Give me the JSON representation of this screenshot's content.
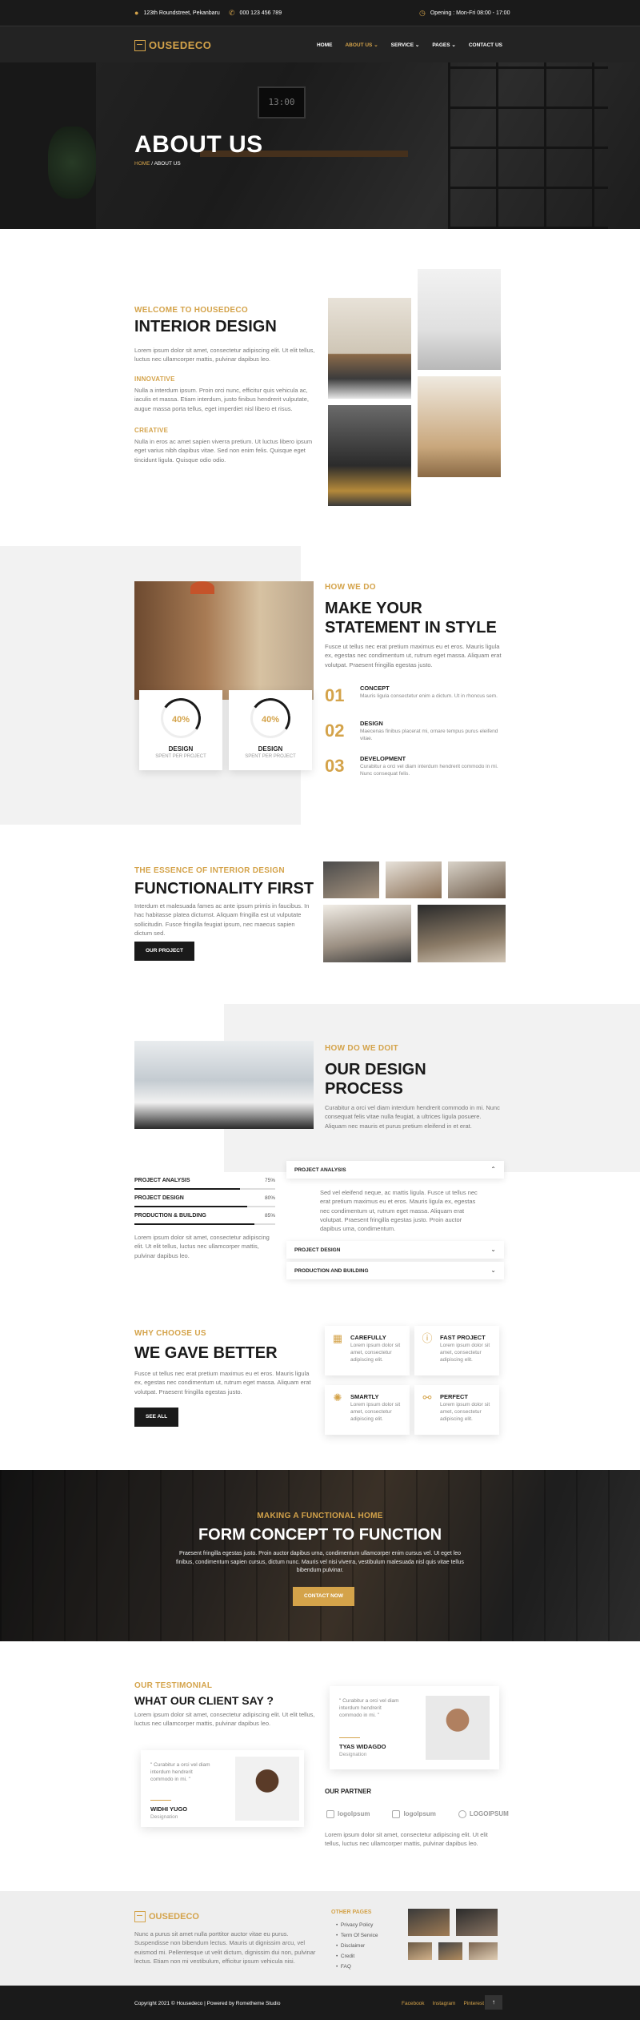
{
  "topbar": {
    "address": "123th Roundstreet, Pekanbaru",
    "phone": "000 123 456 789",
    "hours": "Opening : Mon-Fri 08:00 - 17:00"
  },
  "brand": {
    "logo_text": "OUSEDECO",
    "accent": "#d4a34a"
  },
  "nav": {
    "items": [
      {
        "label": "HOME"
      },
      {
        "label": "ABOUT US ⌄"
      },
      {
        "label": "SERVICE ⌄"
      },
      {
        "label": "PAGES ⌄"
      },
      {
        "label": "CONTACT US"
      }
    ]
  },
  "hero": {
    "title": "ABOUT US",
    "crumb_home": "HOME",
    "crumb_sep": " / ",
    "crumb_current": "ABOUT US",
    "clock": "13:00"
  },
  "intro": {
    "label": "WELCOME TO HOUSEDECO",
    "title": "INTERIOR DESIGN",
    "text": "Lorem ipsum dolor sit amet, consectetur adipiscing elit. Ut elit tellus, luctus nec ullamcorper mattis, pulvinar dapibus leo.",
    "sub1": "INNOVATIVE",
    "sub1_text": "Nulla a interdum ipsum. Proin orci nunc, efficitur quis vehicula ac, iaculis et massa. Etiam interdum, justo finibus hendrerit vulputate, augue massa porta tellus, eget imperdiet nisl libero et risus.",
    "sub2": "CREATIVE",
    "sub2_text": "Nulla in eros ac amet sapien viverra pretium. Ut luctus libero ipsum eget varius nibh dapibus vitae. Sed non enim felis. Quisque eget tincidunt ligula. Quisque odio odio."
  },
  "how": {
    "label": "HOW WE DO",
    "title1": "MAKE YOUR",
    "title2": "STATEMENT IN STYLE",
    "text": "Fusce ut tellus nec erat pretium maximus eu et eros. Mauris ligula ex, egestas nec condimentum ut, rutrum eget massa. Aliquam erat volutpat. Praesent fringilla egestas justo.",
    "cards": [
      {
        "pct": "40%",
        "title": "DESIGN",
        "sub": "SPENT PER PROJECT"
      },
      {
        "pct": "40%",
        "title": "DESIGN",
        "sub": "SPENT PER PROJECT"
      }
    ],
    "steps": [
      {
        "n": "01",
        "title": "CONCEPT",
        "text": "Mauris ligula consectetur enim a dictum. Ut in rhoncus sem."
      },
      {
        "n": "02",
        "title": "DESIGN",
        "text": "Maecenas finibus placerat mi, ornare tempus purus eleifend vitae."
      },
      {
        "n": "03",
        "title": "DEVELOPMENT",
        "text": "Curabitur a orci vel diam interdum hendrerit commodo in mi. Nunc consequat felis."
      }
    ]
  },
  "essence": {
    "label": "THE ESSENCE OF INTERIOR DESIGN",
    "title": "FUNCTIONALITY FIRST",
    "text": "Interdum et malesuada fames ac ante ipsum primis in faucibus. In hac habitasse platea dictumst. Aliquam fringilla est ut vulputate sollicitudin. Fusce fringilla feugiat ipsum, nec maecus sapien dictum sed.",
    "button": "OUR PROJECT"
  },
  "process": {
    "label": "HOW DO WE DOIT",
    "title1": "OUR DESIGN",
    "title2": "PROCESS",
    "text": "Curabitur a orci vel diam interdum hendrerit commodo in mi. Nunc consequat felis vitae nulla feugiat, a ultrices ligula posuere. Aliquam nec mauris et purus pretium eleifend in et erat.",
    "bars": [
      {
        "label": "PROJECT ANALYSIS",
        "pct": "75%",
        "value": 0.75
      },
      {
        "label": "PROJECT DESIGN",
        "pct": "80%",
        "value": 0.8
      },
      {
        "label": "PRODUCTION & BUILDING",
        "pct": "85%",
        "value": 0.85
      }
    ],
    "bars_text": "Lorem ipsum dolor sit amet, consectetur adipiscing elit. Ut elit tellus, luctus nec ullamcorper mattis, pulvinar dapibus leo.",
    "acc1": "PROJECT ANALYSIS",
    "acc1_text": "Sed vel eleifend neque, ac mattis ligula. Fusce ut tellus nec erat pretium maximus eu et eros. Mauris ligula ex, egestas nec condimentum ut, rutrum eget massa. Aliquam erat volutpat. Praesent fringilla egestas justo. Proin auctor dapibus uma, condimentum.",
    "acc2": "PROJECT DESIGN",
    "acc3": "PRODUCTION AND BUILDING"
  },
  "why": {
    "label": "WHY CHOOSE US",
    "title": "WE GAVE BETTER",
    "text": "Fusce ut tellus nec erat pretium maximus eu et eros. Mauris ligula ex, egestas nec condimentum ut, rutrum eget massa. Aliquam erat volutpat. Praesent fringilla egestas justo.",
    "button": "SEE ALL",
    "features": [
      {
        "icon": "calendar-icon",
        "title": "CAREFULLY",
        "text": "Lorem ipsum dolor sit amet, consectetur adipiscing elit."
      },
      {
        "icon": "lightbulb-icon",
        "title": "FAST PROJECT",
        "text": "Lorem ipsum dolor sit amet, consectetur adipiscing elit."
      },
      {
        "icon": "idea-icon",
        "title": "SMARTLY",
        "text": "Lorem ipsum dolor sit amet, consectetur adipiscing elit."
      },
      {
        "icon": "handshake-icon",
        "title": "PERFECT",
        "text": "Lorem ipsum dolor sit amet, consectetur adipiscing elit."
      }
    ]
  },
  "banner": {
    "label": "MAKING A FUNCTIONAL HOME",
    "title": "FORM CONCEPT TO FUNCTION",
    "text": "Praesent fringilla egestas justo. Proin auctor dapibus urna, condimentum ullamcorper enim cursus vel. Ut eget leo finibus, condimentum sapien cursus, dictum nunc. Mauris vel nisi viverra, vestibulum malesuada nisl quis vitae tellus bibendum pulvinar.",
    "button": "CONTACT NOW"
  },
  "testimonial": {
    "label": "OUR TESTIMONIAL",
    "title": "WHAT OUR CLIENT SAY ?",
    "text": "Lorem ipsum dolor sit amet, consectetur adipiscing elit. Ut elit tellus, luctus nec ullamcorper mattis, pulvinar dapibus leo.",
    "t1": {
      "quote": "\" Curabitur a orci vel diam interdum hendrerit commodo in mi. \"",
      "name": "TYAS WIDAGDO",
      "role": "Designation"
    },
    "t2": {
      "quote": "\" Curabitur a orci vel diam interdum hendrerit commodo in mi. \"",
      "name": "WIDHI YUGO",
      "role": "Designation"
    },
    "partner_title": "OUR PARTNER",
    "partners": [
      "logolpsum",
      "logolpsum",
      "LOGOIPSUM"
    ],
    "partner_text": "Lorem ipsum dolor sit amet, consectetur adipiscing elit. Ut elit tellus, luctus nec ullamcorper mattis, pulvinar dapibus leo."
  },
  "footer": {
    "logo_text": "OUSEDECO",
    "text": "Nunc a purus sit amet nulla porttitor auctor vitae eu purus. Suspendisse non bibendum lectus. Mauris ut dignissim arcu, vel euismod mi. Pellentesque ut velit dictum, dignissim dui non, pulvinar lectus. Etiam non mi vestibulum, efficitur ipsum vehicula nisi.",
    "links_title": "OTHER PAGES",
    "links": [
      "Privacy Policy",
      "Term Of Service",
      "Disclaimer",
      "Credit",
      "FAQ"
    ],
    "copyright": "Copyright 2021 © Housedeco | Powered by Rometheme Studio",
    "social": [
      "Facebook",
      "Instagram",
      "Pinterest"
    ],
    "top": "↑"
  }
}
